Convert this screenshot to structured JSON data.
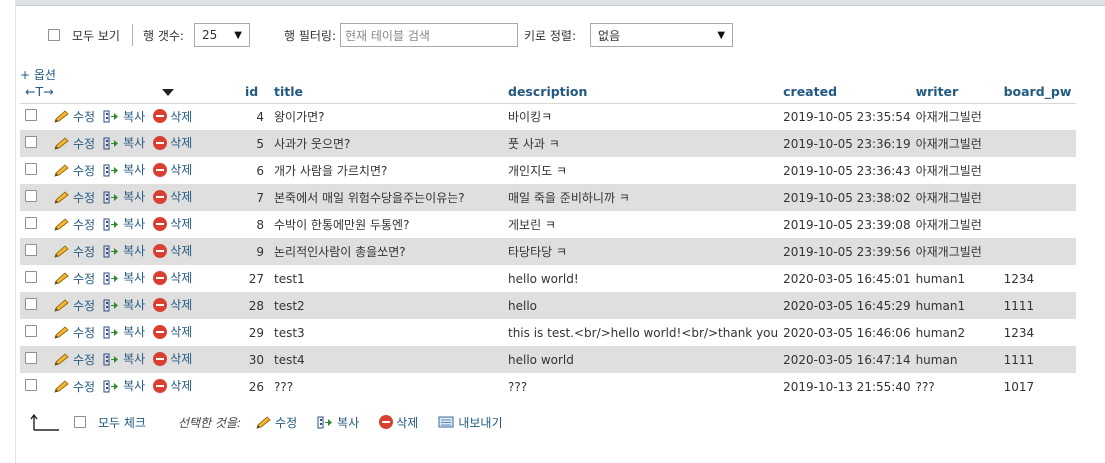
{
  "controls": {
    "show_all_label": "모두 보기",
    "row_count_label": "행 갯수:",
    "row_count_value": "25",
    "row_filter_label": "행 필터링:",
    "row_filter_placeholder": "현재 테이블 검색",
    "sort_by_key_label": "키로 정렬:",
    "sort_by_key_value": "없음"
  },
  "options_link": "+ 옵션",
  "resize_arrows": "←T→",
  "table": {
    "columns": [
      "id",
      "title",
      "description",
      "created",
      "writer",
      "board_pw"
    ],
    "actions": {
      "edit": "수정",
      "copy": "복사",
      "delete": "삭제"
    },
    "rows": [
      {
        "id": "4",
        "title": "왕이가면?",
        "description": "바이킹ㅋ",
        "created": "2019-10-05 23:35:54",
        "writer": "아재개그빌런",
        "board_pw": ""
      },
      {
        "id": "5",
        "title": "사과가 웃으면?",
        "description": "풋 사과 ㅋ",
        "created": "2019-10-05 23:36:19",
        "writer": "아재개그빌런",
        "board_pw": ""
      },
      {
        "id": "6",
        "title": "개가 사람을 가르치면?",
        "description": "개인지도 ㅋ",
        "created": "2019-10-05 23:36:43",
        "writer": "아재개그빌런",
        "board_pw": ""
      },
      {
        "id": "7",
        "title": "본죽에서 매일 위험수당을주는이유는?",
        "description": "매일 죽을 준비하니까 ㅋ",
        "created": "2019-10-05 23:38:02",
        "writer": "아재개그빌런",
        "board_pw": ""
      },
      {
        "id": "8",
        "title": "수박이 한통에만원 두통엔?",
        "description": "게보린 ㅋ",
        "created": "2019-10-05 23:39:08",
        "writer": "아재개그빌런",
        "board_pw": ""
      },
      {
        "id": "9",
        "title": "논리적인사람이 총을쏘면?",
        "description": "타당타당 ㅋ",
        "created": "2019-10-05 23:39:56",
        "writer": "아재개그빌런",
        "board_pw": ""
      },
      {
        "id": "27",
        "title": "test1",
        "description": "hello world!",
        "created": "2020-03-05 16:45:01",
        "writer": "human1",
        "board_pw": "1234"
      },
      {
        "id": "28",
        "title": "test2",
        "description": "hello",
        "created": "2020-03-05 16:45:29",
        "writer": "human1",
        "board_pw": "1111"
      },
      {
        "id": "29",
        "title": "test3",
        "description": "this is test.<br/>hello world!<br/>thank you",
        "created": "2020-03-05 16:46:06",
        "writer": "human2",
        "board_pw": "1234"
      },
      {
        "id": "30",
        "title": "test4",
        "description": "hello world",
        "created": "2020-03-05 16:47:14",
        "writer": "human",
        "board_pw": "1111"
      },
      {
        "id": "26",
        "title": "???",
        "description": "???",
        "created": "2019-10-13 21:55:40",
        "writer": "???",
        "board_pw": "1017"
      }
    ]
  },
  "bottom": {
    "check_all_label": "모두 체크",
    "with_selected_label": "선택한 것을:",
    "edit_label": "수정",
    "copy_label": "복사",
    "delete_label": "삭제",
    "export_label": "내보내기"
  },
  "colors": {
    "link": "#235a81",
    "row_alt": "#dfdfdf",
    "delete_red": "#d94032"
  }
}
